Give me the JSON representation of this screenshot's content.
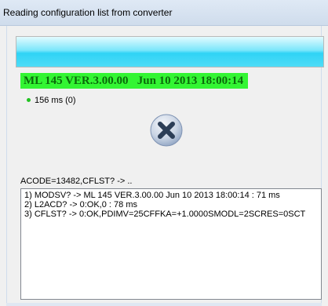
{
  "window": {
    "title": "Reading configuration list from converter"
  },
  "progress": {
    "value_fraction": 1.0,
    "color": "#2fd3f5"
  },
  "device": {
    "version_text": "ML 145 VER.3.00.00   Jun 10 2013 18:00:14",
    "highlight_color": "#33f533",
    "text_color": "#0b6b0b"
  },
  "status": {
    "indicator_color": "#22c322",
    "timing_text": "156 ms (0)"
  },
  "stop_button": {
    "icon": "close-x-icon",
    "color": "#2c3e57"
  },
  "command": {
    "current_text": "ACODE=13482,CFLST? -> .."
  },
  "log": {
    "lines": [
      "1) MODSV? -> ML 145 VER.3.00.00   Jun 10 2013 18:00:14 : 71 ms",
      "2) L2ACD? -> 0:OK,0 : 78 ms",
      "3) CFLST? -> 0:OK,PDIMV=25CFFKA=+1.0000SMODL=2SCRES=0SCT"
    ]
  }
}
